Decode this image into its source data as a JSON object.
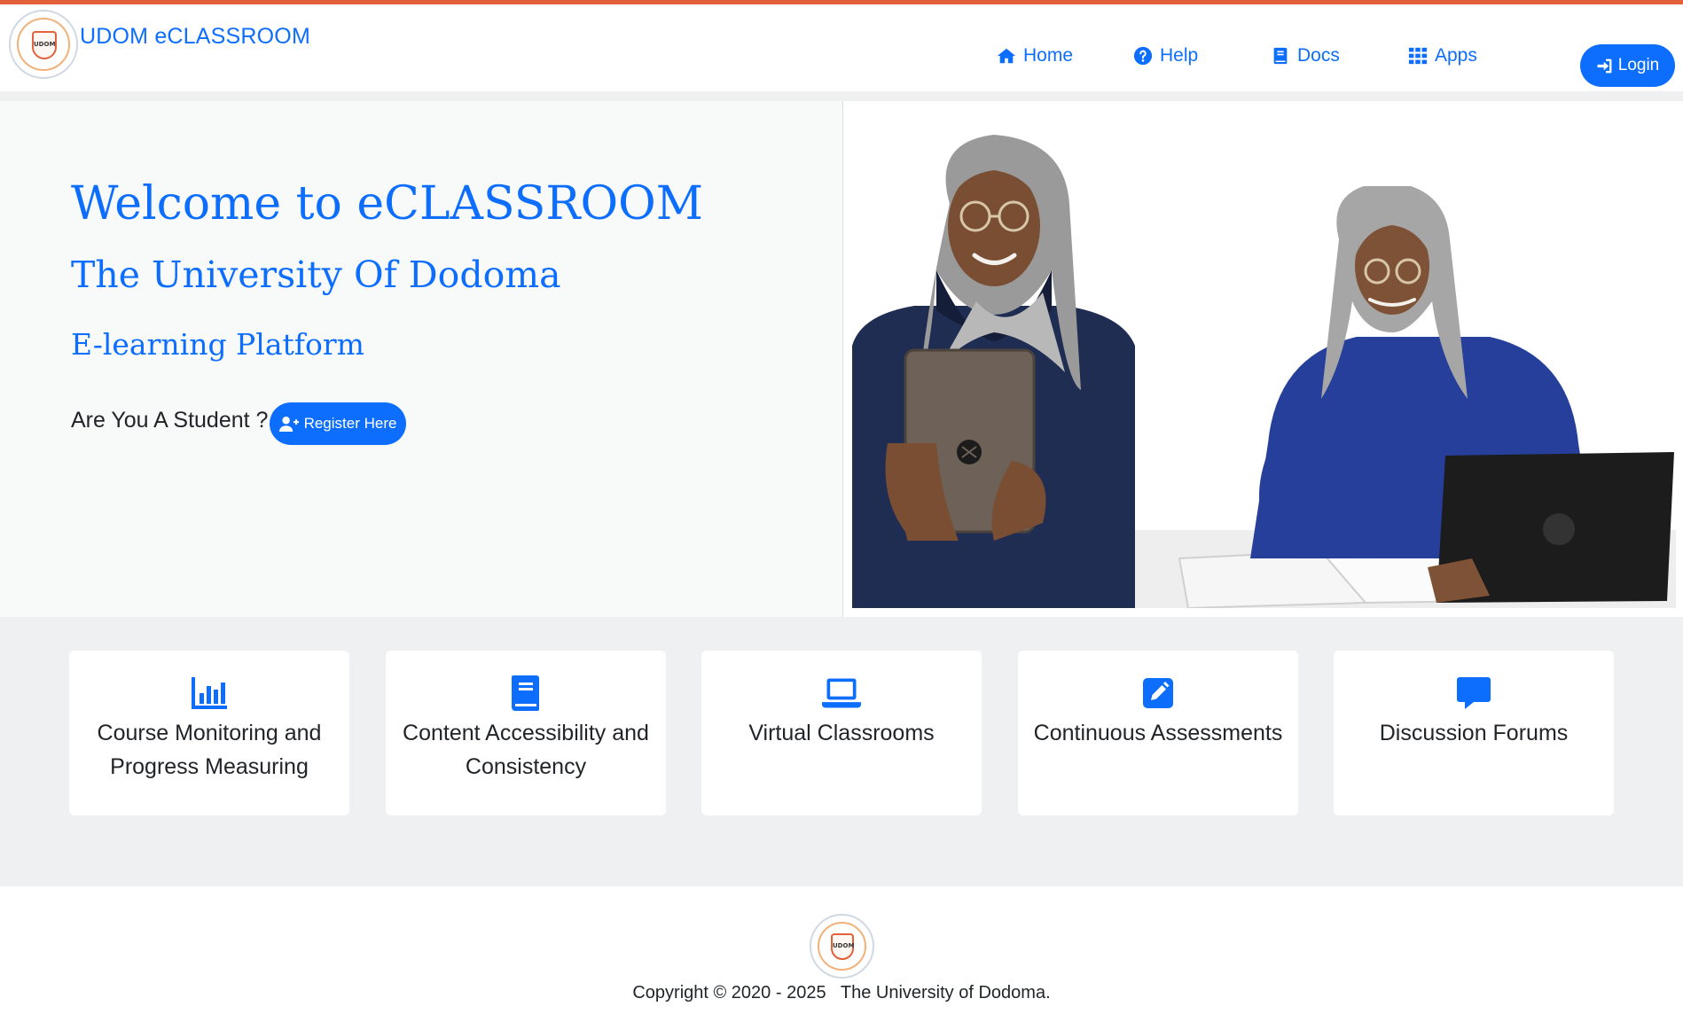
{
  "brand": {
    "name": "UDOM eCLASSROOM",
    "logo_text": "UDOM"
  },
  "nav": {
    "home": "Home",
    "help": "Help",
    "docs": "Docs",
    "apps": "Apps",
    "login": "Login"
  },
  "hero": {
    "welcome": "Welcome to eCLASSROOM",
    "university": "The University Of Dodoma",
    "platform": "E-learning Platform",
    "student_question": "Are You A Student ?",
    "register": "Register Here"
  },
  "features": [
    {
      "label": "Course Monitoring and Progress Measuring",
      "icon": "chart-bar-icon"
    },
    {
      "label": "Content Accessibility and Consistency",
      "icon": "book-icon"
    },
    {
      "label": "Virtual Classrooms",
      "icon": "laptop-icon"
    },
    {
      "label": "Continuous Assessments",
      "icon": "edit-icon"
    },
    {
      "label": "Discussion Forums",
      "icon": "comment-icon"
    }
  ],
  "footer": {
    "copyright": "Copyright © 2020 - 2025   The University of Dodoma.",
    "logo_text": "UDOM"
  },
  "colors": {
    "primary": "#0d6efd",
    "accent_bar": "#e2603a",
    "page_bg": "#eef0f2"
  }
}
